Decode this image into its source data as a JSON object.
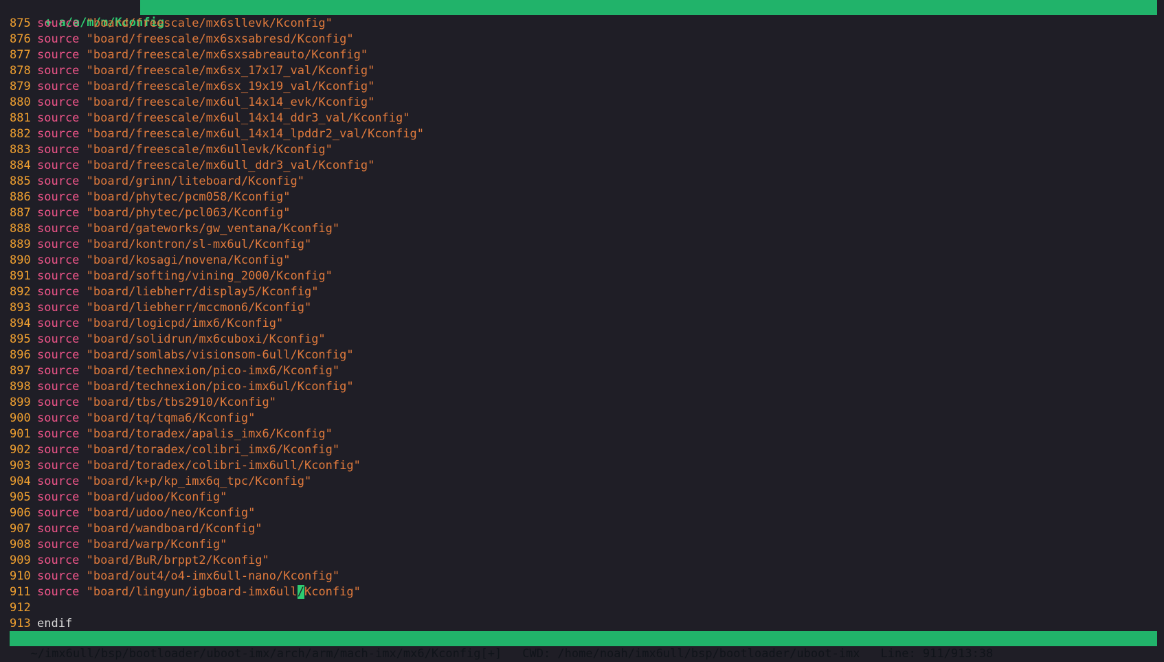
{
  "tab": {
    "label": "+ a/a/m/m/Kconfig"
  },
  "buffer": {
    "cursor_line": "911",
    "lines": [
      {
        "n": "875",
        "kw": "source",
        "str": "\"board/freescale/mx6sllevk/Kconfig\""
      },
      {
        "n": "876",
        "kw": "source",
        "str": "\"board/freescale/mx6sxsabresd/Kconfig\""
      },
      {
        "n": "877",
        "kw": "source",
        "str": "\"board/freescale/mx6sxsabreauto/Kconfig\""
      },
      {
        "n": "878",
        "kw": "source",
        "str": "\"board/freescale/mx6sx_17x17_val/Kconfig\""
      },
      {
        "n": "879",
        "kw": "source",
        "str": "\"board/freescale/mx6sx_19x19_val/Kconfig\""
      },
      {
        "n": "880",
        "kw": "source",
        "str": "\"board/freescale/mx6ul_14x14_evk/Kconfig\""
      },
      {
        "n": "881",
        "kw": "source",
        "str": "\"board/freescale/mx6ul_14x14_ddr3_val/Kconfig\""
      },
      {
        "n": "882",
        "kw": "source",
        "str": "\"board/freescale/mx6ul_14x14_lpddr2_val/Kconfig\""
      },
      {
        "n": "883",
        "kw": "source",
        "str": "\"board/freescale/mx6ullevk/Kconfig\""
      },
      {
        "n": "884",
        "kw": "source",
        "str": "\"board/freescale/mx6ull_ddr3_val/Kconfig\""
      },
      {
        "n": "885",
        "kw": "source",
        "str": "\"board/grinn/liteboard/Kconfig\""
      },
      {
        "n": "886",
        "kw": "source",
        "str": "\"board/phytec/pcm058/Kconfig\""
      },
      {
        "n": "887",
        "kw": "source",
        "str": "\"board/phytec/pcl063/Kconfig\""
      },
      {
        "n": "888",
        "kw": "source",
        "str": "\"board/gateworks/gw_ventana/Kconfig\""
      },
      {
        "n": "889",
        "kw": "source",
        "str": "\"board/kontron/sl-mx6ul/Kconfig\""
      },
      {
        "n": "890",
        "kw": "source",
        "str": "\"board/kosagi/novena/Kconfig\""
      },
      {
        "n": "891",
        "kw": "source",
        "str": "\"board/softing/vining_2000/Kconfig\""
      },
      {
        "n": "892",
        "kw": "source",
        "str": "\"board/liebherr/display5/Kconfig\""
      },
      {
        "n": "893",
        "kw": "source",
        "str": "\"board/liebherr/mccmon6/Kconfig\""
      },
      {
        "n": "894",
        "kw": "source",
        "str": "\"board/logicpd/imx6/Kconfig\""
      },
      {
        "n": "895",
        "kw": "source",
        "str": "\"board/solidrun/mx6cuboxi/Kconfig\""
      },
      {
        "n": "896",
        "kw": "source",
        "str": "\"board/somlabs/visionsom-6ull/Kconfig\""
      },
      {
        "n": "897",
        "kw": "source",
        "str": "\"board/technexion/pico-imx6/Kconfig\""
      },
      {
        "n": "898",
        "kw": "source",
        "str": "\"board/technexion/pico-imx6ul/Kconfig\""
      },
      {
        "n": "899",
        "kw": "source",
        "str": "\"board/tbs/tbs2910/Kconfig\""
      },
      {
        "n": "900",
        "kw": "source",
        "str": "\"board/tq/tqma6/Kconfig\""
      },
      {
        "n": "901",
        "kw": "source",
        "str": "\"board/toradex/apalis_imx6/Kconfig\""
      },
      {
        "n": "902",
        "kw": "source",
        "str": "\"board/toradex/colibri_imx6/Kconfig\""
      },
      {
        "n": "903",
        "kw": "source",
        "str": "\"board/toradex/colibri-imx6ull/Kconfig\""
      },
      {
        "n": "904",
        "kw": "source",
        "str": "\"board/k+p/kp_imx6q_tpc/Kconfig\""
      },
      {
        "n": "905",
        "kw": "source",
        "str": "\"board/udoo/Kconfig\""
      },
      {
        "n": "906",
        "kw": "source",
        "str": "\"board/udoo/neo/Kconfig\""
      },
      {
        "n": "907",
        "kw": "source",
        "str": "\"board/wandboard/Kconfig\""
      },
      {
        "n": "908",
        "kw": "source",
        "str": "\"board/warp/Kconfig\""
      },
      {
        "n": "909",
        "kw": "source",
        "str": "\"board/BuR/brppt2/Kconfig\""
      },
      {
        "n": "910",
        "kw": "source",
        "str": "\"board/out4/o4-imx6ull-nano/Kconfig\""
      },
      {
        "n": "911",
        "kw": "source",
        "str": "\"board/lingyun/igboard-imx6ull",
        "cursor_char": "/",
        "str_after": "Kconfig\""
      },
      {
        "n": "912",
        "kw": "",
        "str": ""
      },
      {
        "n": "913",
        "kw": "endif",
        "str": ""
      }
    ]
  },
  "statusline": {
    "file": "~/imx6ull/bsp/bootloader/uboot-imx/arch/arm/mach-imx/mx6/Kconfig[+]",
    "cwd": "CWD: /home/noah/imx6ull/bsp/bootloader/uboot-imx",
    "position": "Line: 911/913:38"
  },
  "colors": {
    "background": "#1f1e26",
    "accent_green": "#21b36a",
    "line_number": "#f0a030",
    "keyword": "#f0558a",
    "string": "#e07a3c"
  }
}
